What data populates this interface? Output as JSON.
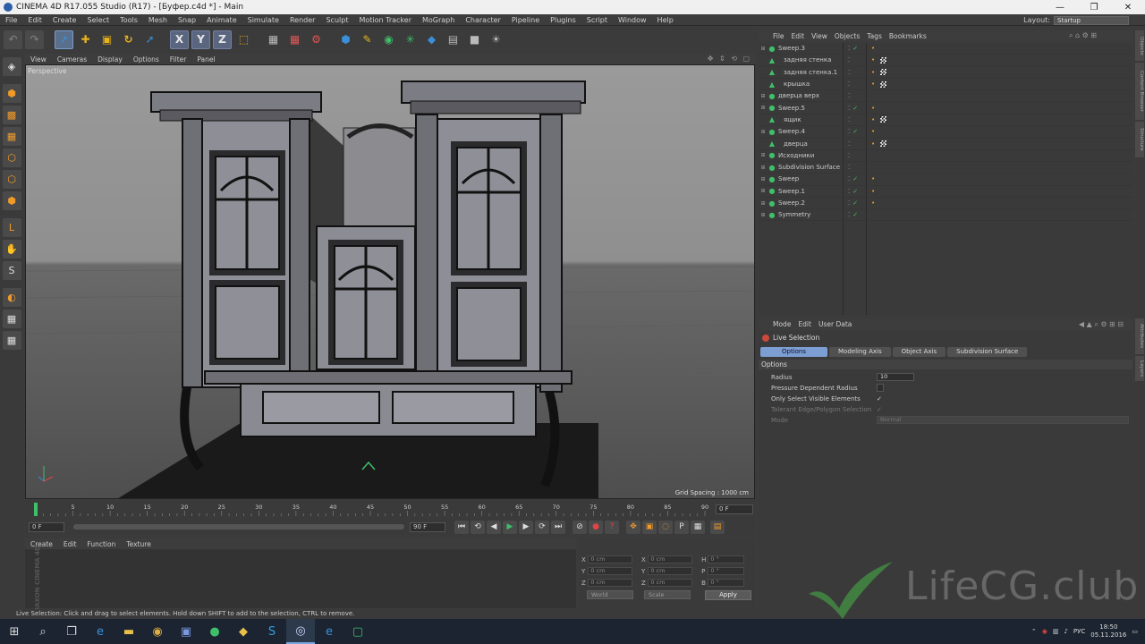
{
  "window": {
    "title": "CINEMA 4D R17.055 Studio (R17) - [Буфер.c4d *] - Main"
  },
  "menubar": [
    "File",
    "Edit",
    "Create",
    "Select",
    "Tools",
    "Mesh",
    "Snap",
    "Animate",
    "Simulate",
    "Render",
    "Sculpt",
    "Motion Tracker",
    "MoGraph",
    "Character",
    "Pipeline",
    "Plugins",
    "Script",
    "Window",
    "Help"
  ],
  "layout": {
    "label": "Layout:",
    "value": "Startup"
  },
  "viewport": {
    "menu": [
      "View",
      "Cameras",
      "Display",
      "Options",
      "Filter",
      "Panel"
    ],
    "camera": "Perspective",
    "grid_spacing": "Grid Spacing : 1000 cm"
  },
  "timeline": {
    "ticks": [
      "0",
      "5",
      "10",
      "15",
      "20",
      "25",
      "30",
      "35",
      "40",
      "45",
      "50",
      "55",
      "60",
      "65",
      "70",
      "75",
      "80",
      "85",
      "90"
    ],
    "frame_end_field": "0 F",
    "current": "0 F",
    "min": "0 F",
    "max": "90 F",
    "max2": "90 F"
  },
  "material": {
    "menu": [
      "Create",
      "Edit",
      "Function",
      "Texture"
    ]
  },
  "coords": {
    "rows": [
      {
        "a": "X",
        "av": "0 cm",
        "b": "X",
        "bv": "0 cm",
        "c": "H",
        "cv": "0 °"
      },
      {
        "a": "Y",
        "av": "0 cm",
        "b": "Y",
        "bv": "0 cm",
        "c": "P",
        "cv": "0 °"
      },
      {
        "a": "Z",
        "av": "0 cm",
        "b": "Z",
        "bv": "0 cm",
        "c": "B",
        "cv": "0 °"
      }
    ],
    "world": "World",
    "scale": "Scale",
    "apply": "Apply"
  },
  "status": "Live Selection: Click and drag to select elements. Hold down SHIFT to add to the selection, CTRL to remove.",
  "object_manager": {
    "menu": [
      "File",
      "Edit",
      "View",
      "Objects",
      "Tags",
      "Bookmarks"
    ],
    "objects": [
      {
        "name": "Sweep.3",
        "child": false,
        "check": true,
        "tags": "•"
      },
      {
        "name": "задняя стенка",
        "child": true,
        "check": false,
        "tags": "• ▣"
      },
      {
        "name": "задняя стенка.1",
        "child": true,
        "check": false,
        "tags": "• ▣"
      },
      {
        "name": "крышка",
        "child": true,
        "check": false,
        "tags": "• ▣"
      },
      {
        "name": "дверца верх",
        "child": false,
        "check": false,
        "tags": ""
      },
      {
        "name": "Sweep.5",
        "child": false,
        "check": true,
        "tags": "•"
      },
      {
        "name": "ящик",
        "child": true,
        "check": false,
        "tags": "• ▣"
      },
      {
        "name": "Sweep.4",
        "child": false,
        "check": true,
        "tags": "•"
      },
      {
        "name": "дверца",
        "child": true,
        "check": false,
        "tags": "• ▣"
      },
      {
        "name": "Исходники",
        "child": false,
        "check": false,
        "tags": ""
      },
      {
        "name": "Subdivision Surface",
        "child": false,
        "check": false,
        "tags": ""
      },
      {
        "name": "Sweep",
        "child": false,
        "check": true,
        "tags": "•"
      },
      {
        "name": "Sweep.1",
        "child": false,
        "check": true,
        "tags": "•"
      },
      {
        "name": "Sweep.2",
        "child": false,
        "check": true,
        "tags": "•"
      },
      {
        "name": "Symmetry",
        "child": false,
        "check": true,
        "tags": ""
      }
    ]
  },
  "attribute_manager": {
    "menu": [
      "Mode",
      "Edit",
      "User Data"
    ],
    "title": "Live Selection",
    "tabs": [
      "Options",
      "Modeling Axis",
      "Object Axis",
      "Subdivision Surface"
    ],
    "section": "Options",
    "fields": [
      {
        "label": "Radius",
        "value": "10"
      },
      {
        "label": "Pressure Dependent Radius",
        "value": ""
      },
      {
        "label": "Only Select Visible Elements",
        "value": "✓"
      },
      {
        "label": "Tolerant Edge/Polygon Selection",
        "value": "✓"
      },
      {
        "label": "Mode",
        "value": "Normal"
      }
    ]
  },
  "side_tabs": [
    "Objects",
    "Content Browser",
    "Structure",
    "Attributes",
    "Layers"
  ],
  "watermark": "LifeCG.club",
  "maxon": "MAXON CINEMA 4D",
  "tray": {
    "lang": "РУС",
    "time": "18:50",
    "date": "05.11.2016"
  },
  "colors": {
    "accent": "#7d9ed2",
    "object_green": "#3fbf6a",
    "tag_orange": "#f09a2a"
  }
}
